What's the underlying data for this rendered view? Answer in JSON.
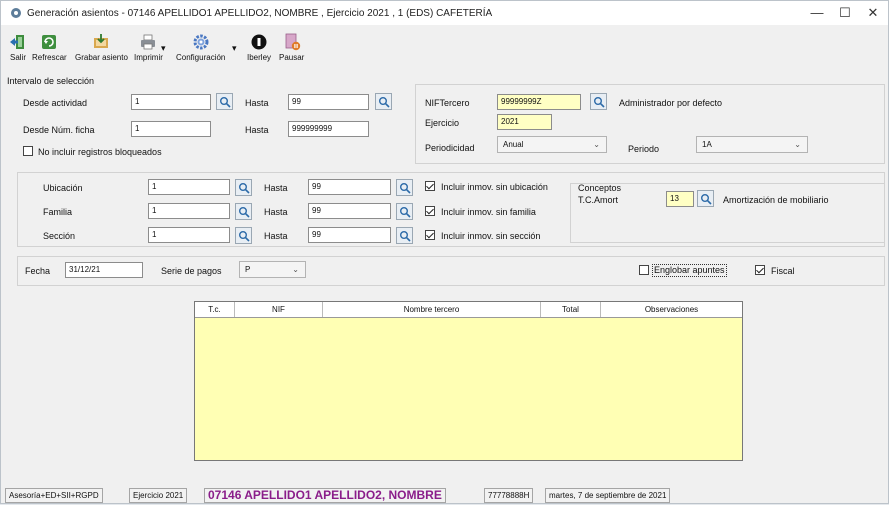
{
  "window": {
    "title": "Generación asientos - 07146 APELLIDO1 APELLIDO2, NOMBRE , Ejercicio 2021 , 1  (EDS) CAFETERÍA",
    "minimize": "—",
    "maximize": "☐",
    "close": "✕"
  },
  "toolbar": {
    "salir": "Salir",
    "refrescar": "Refrescar",
    "grabar": "Grabar asiento",
    "imprimir": "Imprimir",
    "configuracion": "Configuración",
    "iberley": "Iberley",
    "pausar": "Pausar",
    "dropdown_marker": "▾"
  },
  "intervalo": {
    "legend": "Intervalo de selección",
    "desde_actividad_label": "Desde actividad",
    "desde_actividad_value": "1",
    "hasta_label": "Hasta",
    "hasta_actividad_value": "99",
    "desde_ficha_label": "Desde Núm. ficha",
    "desde_ficha_value": "1",
    "hasta_ficha_value": "999999999",
    "no_incluir_label": "No incluir registros bloqueados",
    "no_incluir_checked": false
  },
  "tercero": {
    "nif_label": "NIFTercero",
    "nif_value": "99999999Z",
    "nif_desc": "Administrador por defecto",
    "ejercicio_label": "Ejercicio",
    "ejercicio_value": "2021",
    "periodicidad_label": "Periodicidad",
    "periodicidad_value": "Anual",
    "periodo_label": "Periodo",
    "periodo_value": "1A"
  },
  "inmov": {
    "ubicacion_label": "Ubicación",
    "ubicacion_from": "1",
    "ubicacion_to": "99",
    "familia_label": "Familia",
    "familia_from": "1",
    "familia_to": "99",
    "seccion_label": "Sección",
    "seccion_from": "1",
    "seccion_to": "99",
    "hasta_label": "Hasta",
    "chk_ubicacion_label": "Incluir inmov. sin ubicación",
    "chk_ubicacion": true,
    "chk_familia_label": "Incluir inmov. sin familia",
    "chk_familia": true,
    "chk_seccion_label": "Incluir inmov. sin sección",
    "chk_seccion": true
  },
  "conceptos": {
    "legend": "Conceptos",
    "tc_label": "T.C.Amort",
    "tc_value": "13",
    "tc_desc": "Amortización de mobiliario"
  },
  "fecha_row": {
    "fecha_label": "Fecha",
    "fecha_value": "31/12/21",
    "serie_label": "Serie de pagos",
    "serie_value": "P",
    "englobar_label": "Englobar apuntes",
    "englobar_checked": false,
    "fiscal_label": "Fiscal",
    "fiscal_checked": true
  },
  "grid": {
    "columns": [
      "T.c.",
      "NIF",
      "Nombre tercero",
      "Total",
      "Observaciones"
    ],
    "rows": []
  },
  "status": {
    "modulos": "Asesoría+ED+SII+RGPD",
    "ejercicio": "Ejercicio 2021",
    "empresa": "07146 APELLIDO1 APELLIDO2, NOMBRE",
    "codigo": "77778888H",
    "fecha": "martes, 7 de septiembre de 2021"
  },
  "colors": {
    "grid_background": "#ffffb4",
    "yellow_input": "#ffffc4",
    "empresa_text": "#8a1d8a"
  }
}
